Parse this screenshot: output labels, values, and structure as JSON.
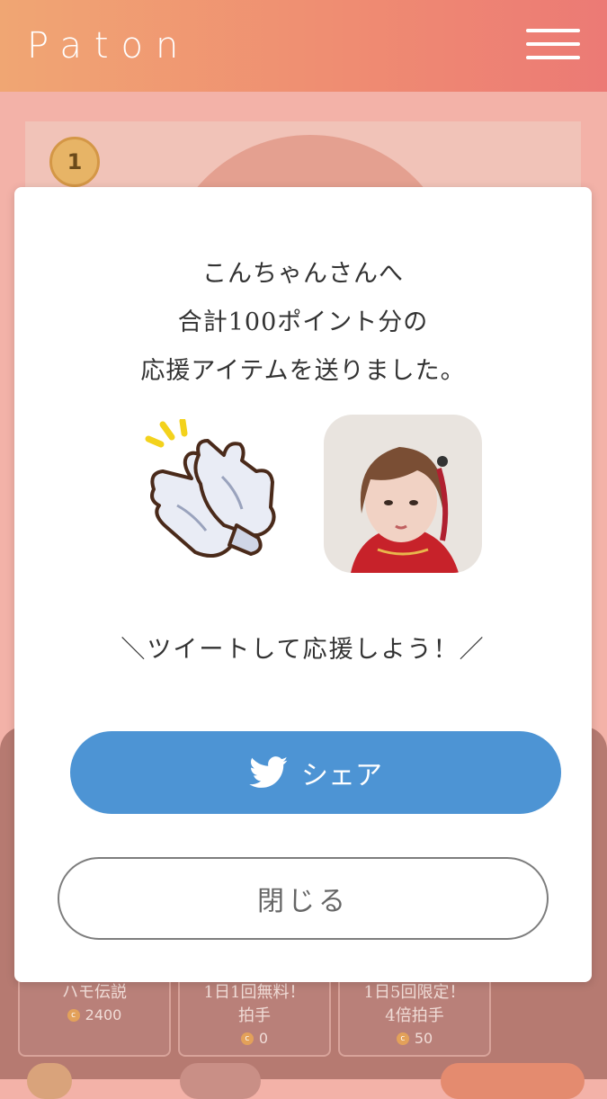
{
  "header": {
    "logo_text": "Paton",
    "menu_icon": "hamburger-menu-icon"
  },
  "background": {
    "rank_number": "1",
    "cards": [
      {
        "line1": "ハモ伝説",
        "price": "2400"
      },
      {
        "line1": "1日1回無料！",
        "line2": "拍手",
        "price": "0"
      },
      {
        "line1": "1日5回限定！",
        "line2": "4倍拍手",
        "price": "50"
      }
    ],
    "coin_symbol": "c"
  },
  "modal": {
    "message_line1": "こんちゃんさんへ",
    "message_line2": "合計100ポイント分の",
    "message_line3": "応援アイテムを送りました。",
    "cheer_text": "＼ツイートして応援しよう！／",
    "share_label": "シェア",
    "close_label": "閉じる",
    "item_icon": "clapping-gloves-icon",
    "share_icon": "twitter-bird-icon"
  },
  "colors": {
    "header_gradient_start": "#f0a673",
    "header_gradient_end": "#ec7a75",
    "share_button": "#4d94d4",
    "overlay_page": "#f3b2a8"
  }
}
